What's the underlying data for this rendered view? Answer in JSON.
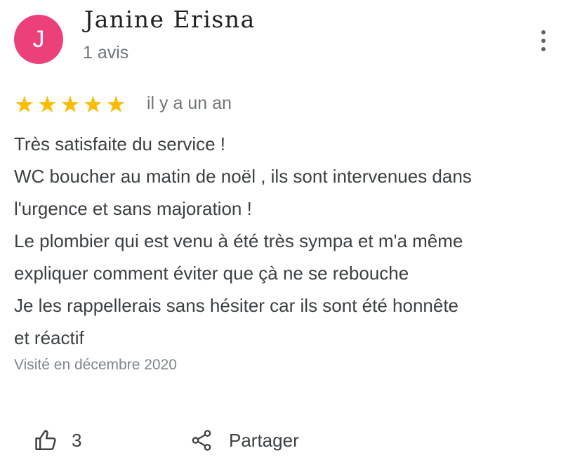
{
  "author": {
    "initial": "J",
    "name": "Janine Erisna",
    "review_count": "1 avis",
    "avatar_color": "#ec407a"
  },
  "menu": {
    "icon": "more-vert-icon"
  },
  "rating": {
    "stars": 5,
    "max": 5,
    "star_color": "#fbbc04",
    "time_ago": "il y a un an"
  },
  "review": {
    "lines": [
      "Très satisfaite du service !",
      "WC boucher au matin de noël , ils sont intervenues dans",
      "l'urgence et sans majoration !",
      "Le plombier qui est venu à été très sympa et m'a même",
      "expliquer comment éviter que çà ne se rebouche",
      "Je les rappellerais sans hésiter car ils sont été honnête",
      "et réactif"
    ],
    "visit": "Visité en décembre 2020"
  },
  "actions": {
    "like_icon": "thumb-up-icon",
    "like_count": "3",
    "share_icon": "share-icon",
    "share_label": "Partager"
  }
}
